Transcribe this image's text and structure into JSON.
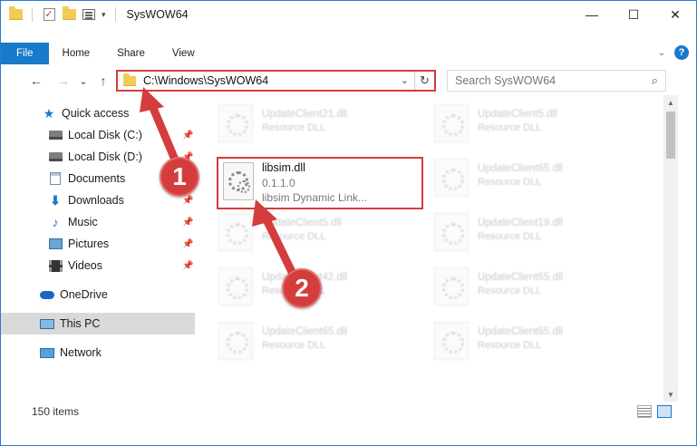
{
  "window": {
    "title": "SysWOW64",
    "controls": {
      "minimize": "—",
      "maximize": "☐",
      "close": "✕"
    }
  },
  "quick_access_toolbar": {
    "dropdown": "▾"
  },
  "ribbon": {
    "tabs": [
      {
        "label": "File"
      },
      {
        "label": "Home"
      },
      {
        "label": "Share"
      },
      {
        "label": "View"
      }
    ],
    "help": "?",
    "collapse": "⌄"
  },
  "navigation": {
    "back": "←",
    "forward": "→",
    "recent": "⌄",
    "up": "↑",
    "address": "C:\\Windows\\SysWOW64",
    "address_dropdown": "⌄",
    "refresh": "↻",
    "search_placeholder": "Search SysWOW64",
    "search_icon": "⌕"
  },
  "sidebar": {
    "items": [
      {
        "label": "Quick access",
        "icon": "star-icon",
        "pinned": false
      },
      {
        "label": "Local Disk (C:)",
        "icon": "disk-icon",
        "pinned": true
      },
      {
        "label": "Local Disk (D:)",
        "icon": "disk-icon",
        "pinned": true
      },
      {
        "label": "Documents",
        "icon": "documents-icon",
        "pinned": true
      },
      {
        "label": "Downloads",
        "icon": "downloads-icon",
        "pinned": true
      },
      {
        "label": "Music",
        "icon": "music-icon",
        "pinned": true
      },
      {
        "label": "Pictures",
        "icon": "pictures-icon",
        "pinned": true
      },
      {
        "label": "Videos",
        "icon": "videos-icon",
        "pinned": true
      },
      {
        "label": "OneDrive",
        "icon": "onedrive-icon",
        "pinned": false
      },
      {
        "label": "This PC",
        "icon": "this-pc-icon",
        "pinned": false,
        "selected": true
      },
      {
        "label": "Network",
        "icon": "network-icon",
        "pinned": false
      }
    ],
    "pin_glyph": "📌"
  },
  "files": {
    "highlighted": {
      "name": "libsim.dll",
      "version": "0.1.1.0",
      "description": "libsim Dynamic Link..."
    },
    "background_tiles": [
      {
        "name": "UpdateClient21.dll",
        "type": "Resource DLL"
      },
      {
        "name": "UpdateClient5.dll",
        "type": "Resource DLL"
      },
      {
        "name": "UpdateClient65.dll",
        "type": "Resource DLL"
      },
      {
        "name": "UpdateClient5.dll",
        "type": "Resource DLL"
      },
      {
        "name": "UpdateClient19.dll",
        "type": "Resource DLL"
      },
      {
        "name": "UpdateClient42.dll",
        "type": "Resource DLL"
      },
      {
        "name": "UpdateClient65.dll",
        "type": "Resource DLL"
      },
      {
        "name": "UpdateClient65.dll",
        "type": "Resource DLL"
      },
      {
        "name": "UpdateClient65.dll",
        "type": "Resource DLL"
      }
    ]
  },
  "status_bar": {
    "item_count": "150 items"
  },
  "annotations": {
    "step1": "1",
    "step2": "2"
  },
  "colors": {
    "accent": "#1979ca",
    "highlight": "#d53c3c"
  }
}
